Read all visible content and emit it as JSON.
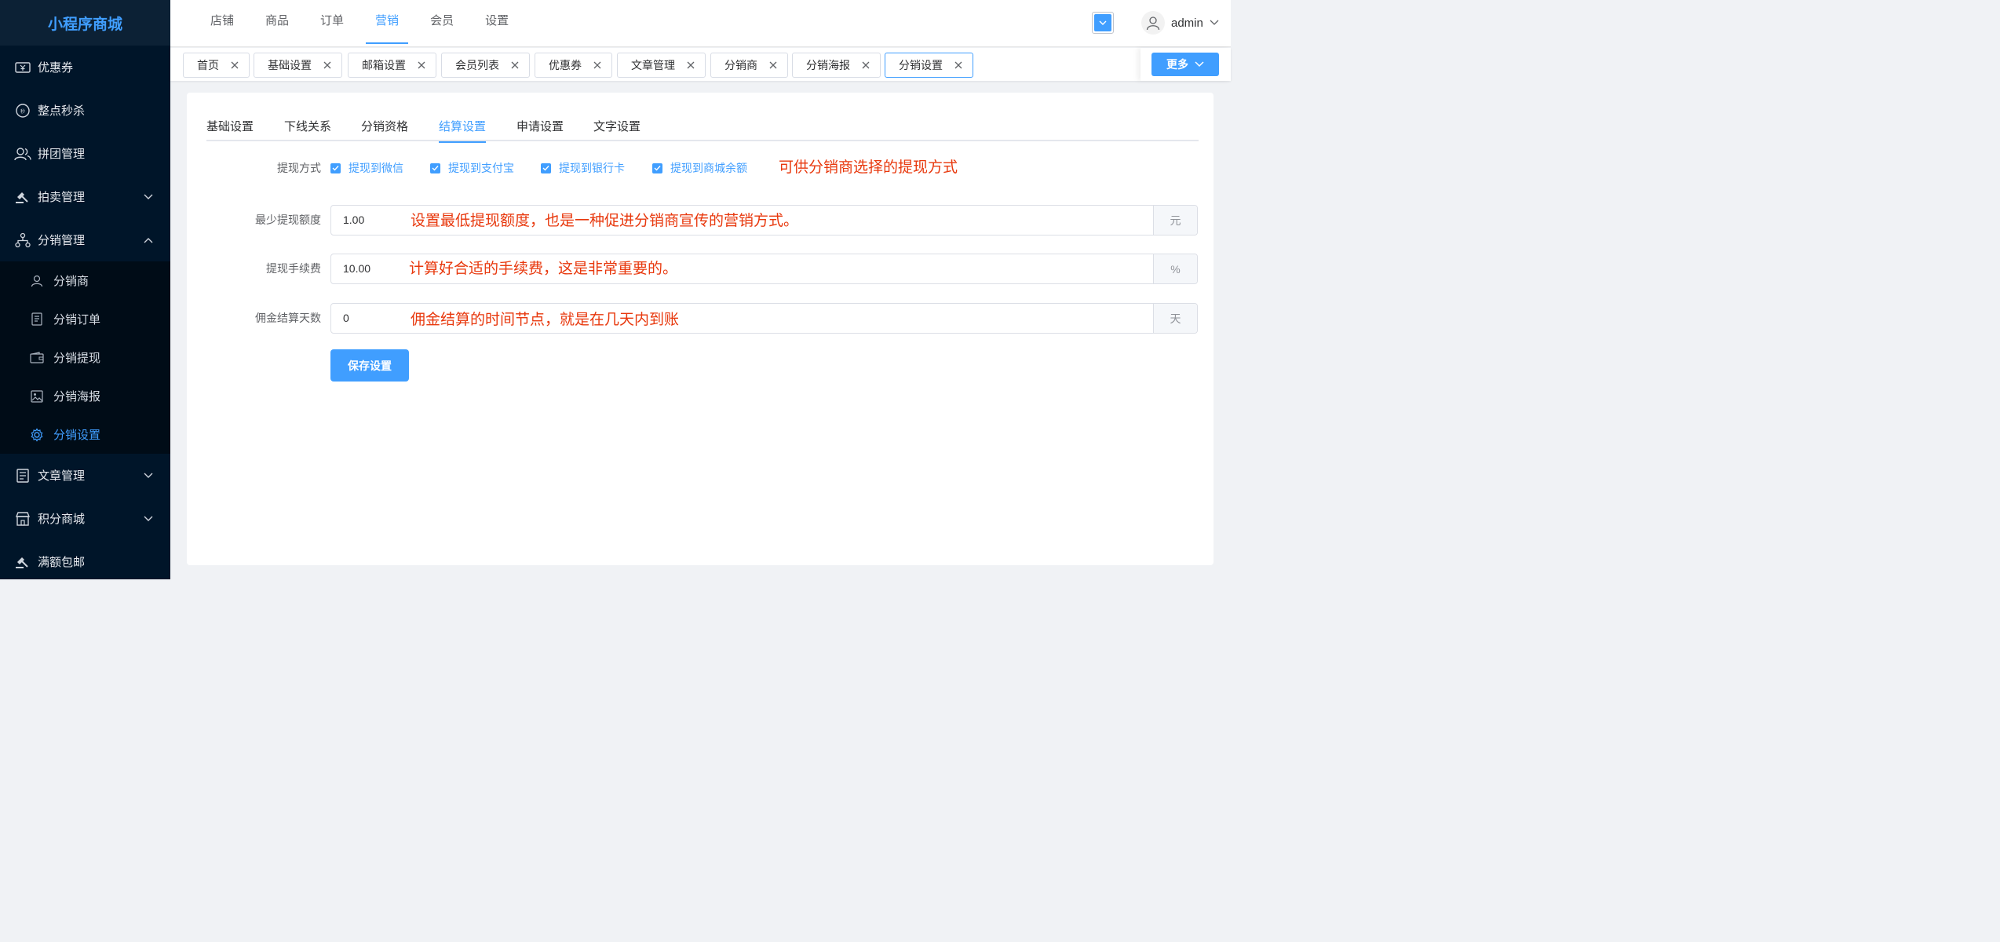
{
  "app": {
    "title": "小程序商城"
  },
  "sidebar": {
    "items": [
      {
        "label": "优惠券",
        "icon": "ticket-icon"
      },
      {
        "label": "整点秒杀",
        "icon": "clock-badge-icon"
      },
      {
        "label": "拼团管理",
        "icon": "users-icon"
      },
      {
        "label": "拍卖管理",
        "icon": "gavel-icon",
        "expandable": true
      },
      {
        "label": "分销管理",
        "icon": "network-icon",
        "expanded": true
      },
      {
        "label": "文章管理",
        "icon": "document-icon",
        "expandable": true
      },
      {
        "label": "积分商城",
        "icon": "shop-icon",
        "expandable": true
      },
      {
        "label": "满额包邮",
        "icon": "gavel-icon"
      }
    ],
    "submenu": [
      {
        "label": "分销商",
        "icon": "user-icon"
      },
      {
        "label": "分销订单",
        "icon": "order-icon"
      },
      {
        "label": "分销提现",
        "icon": "wallet-icon"
      },
      {
        "label": "分销海报",
        "icon": "image-icon"
      },
      {
        "label": "分销设置",
        "icon": "gear-icon",
        "active": true
      }
    ]
  },
  "topnav": {
    "items": [
      "店铺",
      "商品",
      "订单",
      "营销",
      "会员",
      "设置"
    ],
    "active": "营销"
  },
  "user": {
    "name": "admin"
  },
  "tags": [
    "首页",
    "基础设置",
    "邮箱设置",
    "会员列表",
    "优惠券",
    "文章管理",
    "分销商",
    "分销海报",
    "分销设置"
  ],
  "tags_active": "分销设置",
  "more_label": "更多",
  "tabs": [
    "基础设置",
    "下线关系",
    "分销资格",
    "结算设置",
    "申请设置",
    "文字设置"
  ],
  "tabs_active": "结算设置",
  "form": {
    "withdraw_method_label": "提现方式",
    "options": [
      "提现到微信",
      "提现到支付宝",
      "提现到银行卡",
      "提现到商城余额"
    ],
    "min_amount_label": "最少提现额度",
    "min_amount_value": "1.00",
    "min_amount_unit": "元",
    "fee_label": "提现手续费",
    "fee_value": "10.00",
    "fee_unit": "%",
    "days_label": "佣金结算天数",
    "days_value": "0",
    "days_unit": "天",
    "save_label": "保存设置"
  },
  "annotations": {
    "withdraw": "可供分销商选择的提现方式",
    "min_amount": "设置最低提现额度，也是一种促进分销商宣传的营销方式。",
    "fee": "计算好合适的手续费，这是非常重要的。",
    "days": "佣金结算的时间节点，就是在几天内到账"
  },
  "colors": {
    "accent": "#409eff",
    "sidebar_bg": "#001529",
    "annotation": "#e8380d"
  }
}
